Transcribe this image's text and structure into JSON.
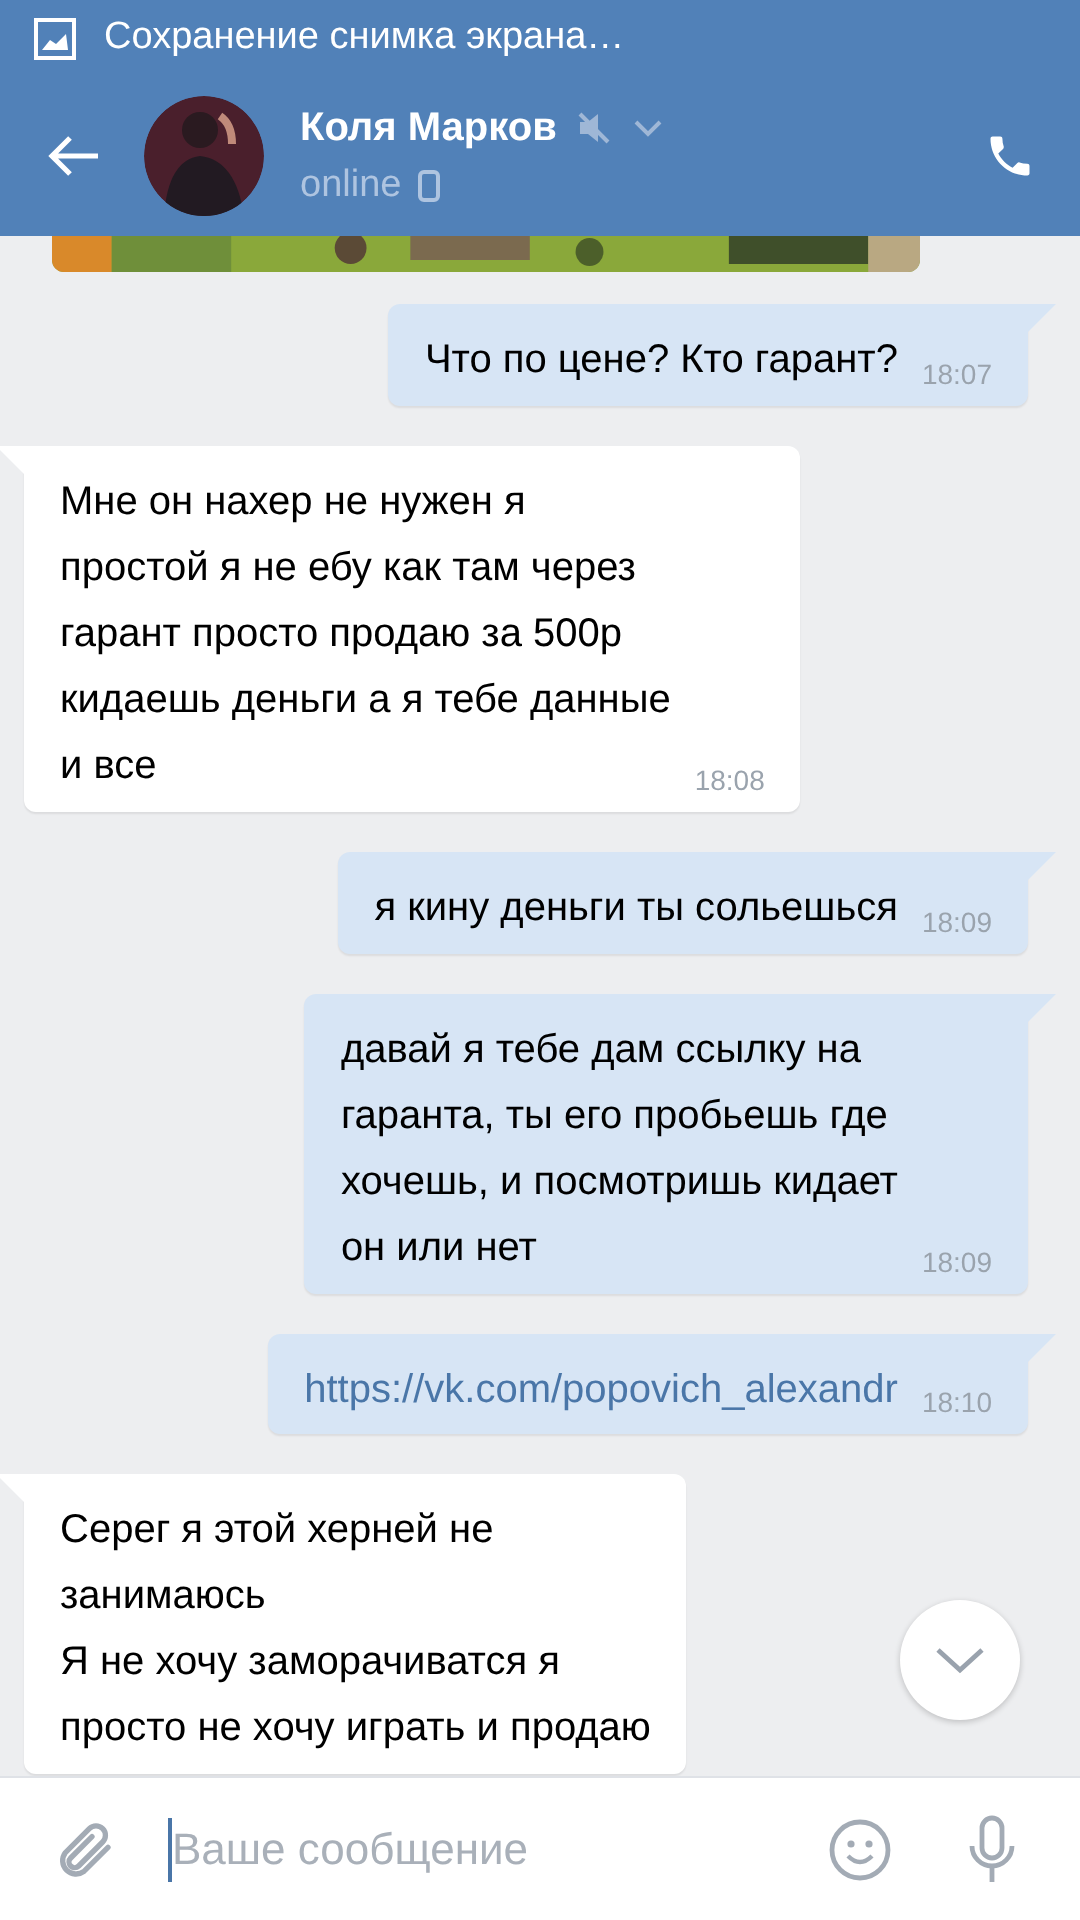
{
  "status_bar": {
    "notification": "Сохранение снимка экрана…"
  },
  "header": {
    "name": "Коля Марков",
    "muted": true,
    "status": "online",
    "on_mobile": true
  },
  "messages": [
    {
      "kind": "picture"
    },
    {
      "kind": "text",
      "outgoing": true,
      "text": "Что по цене? Кто гарант?",
      "time": "18:07"
    },
    {
      "kind": "text",
      "outgoing": false,
      "text": "Мне он нахер не нужен я\nпростой я не ебу как там через\nгарант просто продаю за 500р\nкидаешь деньги а я тебе данные\nи все",
      "time": "18:08"
    },
    {
      "kind": "text",
      "outgoing": true,
      "text": "я кину деньги ты сольешься",
      "time": "18:09"
    },
    {
      "kind": "text",
      "outgoing": true,
      "text": "давай я тебе дам ссылку на\nгаранта, ты его пробьешь где\nхочешь, и посмотришь кидает\nон или нет",
      "time": "18:09"
    },
    {
      "kind": "link",
      "outgoing": true,
      "text": "https://vk.com/popovich_alexandr",
      "time": "18:10"
    },
    {
      "kind": "text",
      "outgoing": false,
      "text": "Серег я этой херней не\nзанимаюсь\nЯ не хочу заморачиватся я\nпросто не хочу играть и продаю"
    }
  ],
  "composer": {
    "placeholder": "Ваше сообщение"
  }
}
